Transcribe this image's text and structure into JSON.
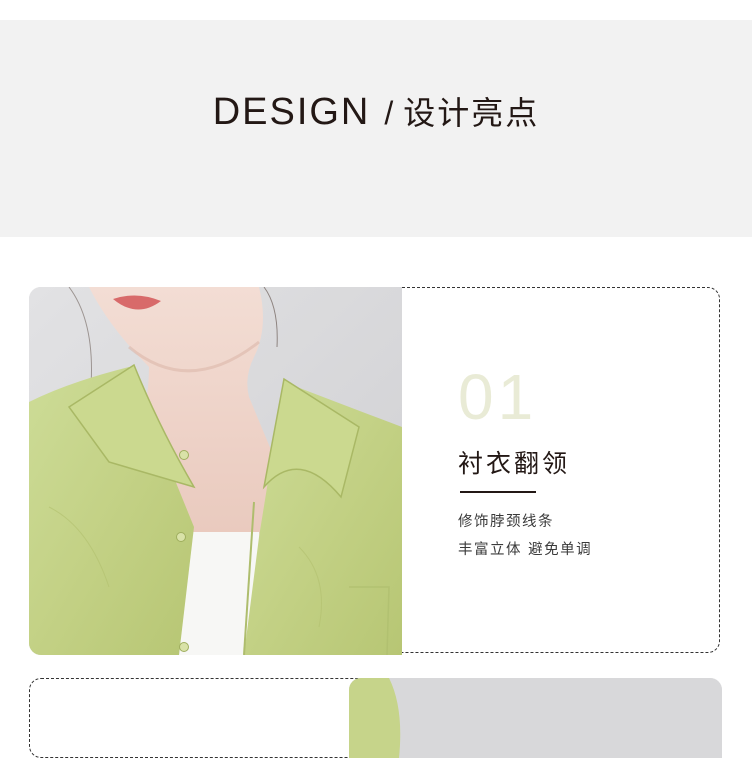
{
  "header": {
    "title_en": "DESIGN",
    "separator": "/",
    "title_cn": "设计亮点"
  },
  "features": [
    {
      "number": "01",
      "title": "衬衣翻领",
      "lines": [
        "修饰脖颈线条",
        "丰富立体 避免单调"
      ]
    }
  ],
  "colors": {
    "banner_bg": "#f2f2f2",
    "shirt": "#c6d48a",
    "number_tint": "#e9ebd6",
    "text_dark": "#231815"
  }
}
